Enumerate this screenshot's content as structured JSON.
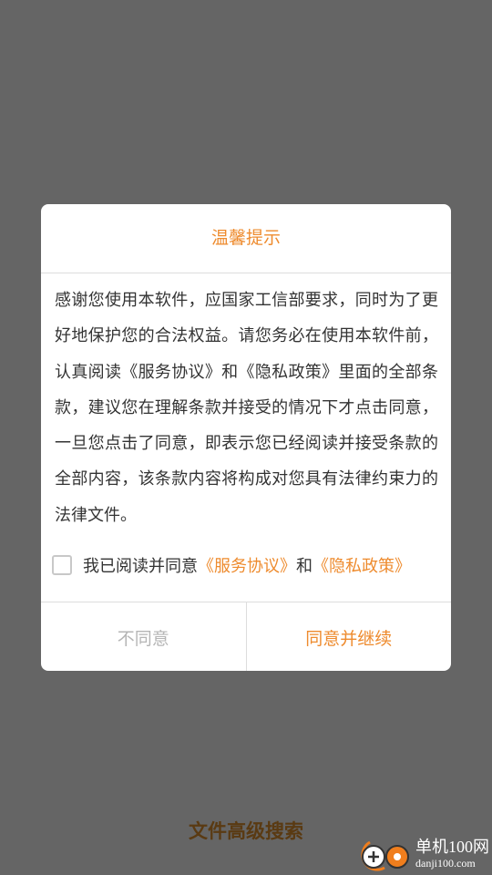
{
  "dialog": {
    "title": "温馨提示",
    "body": "感谢您使用本软件，应国家工信部要求，同时为了更好地保护您的合法权益。请您务必在使用本软件前，认真阅读《服务协议》和《隐私政策》里面的全部条款，建议您在理解条款并接受的情况下才点击同意，一旦您点击了同意，即表示您已经阅读并接受条款的全部内容，该条款内容将构成对您具有法律约束力的法律文件。",
    "agree_prefix": "我已阅读并同意",
    "service_link": "《服务协议》",
    "and_text": "和",
    "privacy_link": "《隐私政策》",
    "agree_checked": false,
    "disagree_label": "不同意",
    "agree_label": "同意并继续"
  },
  "page": {
    "bottom_title": "文件高级搜索"
  },
  "watermark": {
    "brand": "单机100网",
    "domain": "danji100.com"
  },
  "colors": {
    "accent": "#ee8b2e",
    "overlay": "#656565",
    "disabled": "#b5b5b5"
  }
}
